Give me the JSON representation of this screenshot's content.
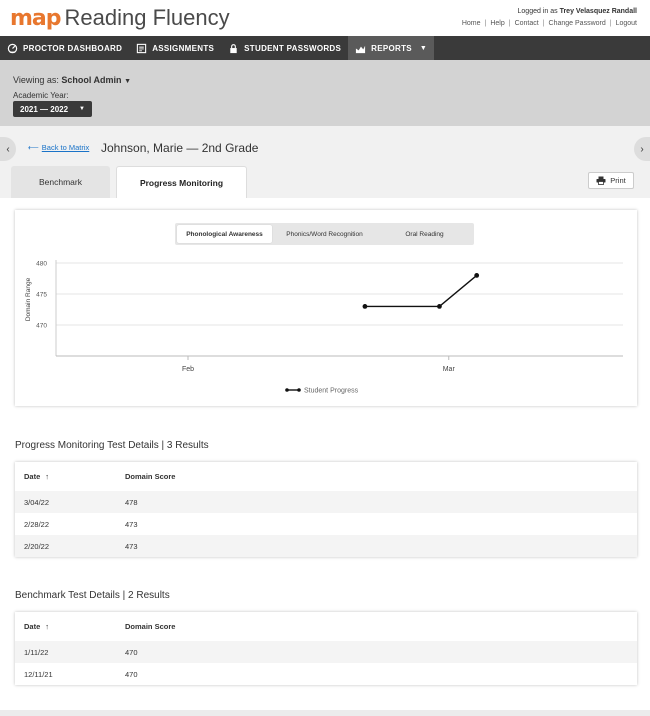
{
  "header": {
    "logo_map": "map",
    "logo_product": "Reading Fluency",
    "logged_in_prefix": "Logged in as",
    "logged_in_user": "Trey Velasquez Randall",
    "links": [
      "Home",
      "Help",
      "Contact",
      "Change Password",
      "Logout"
    ],
    "brand_color": "#e8772e"
  },
  "nav": {
    "items": [
      {
        "label": "PROCTOR DASHBOARD",
        "icon": "proctor-dashboard-icon"
      },
      {
        "label": "ASSIGNMENTS",
        "icon": "assignments-icon"
      },
      {
        "label": "STUDENT PASSWORDS",
        "icon": "lock-icon"
      },
      {
        "label": "REPORTS",
        "icon": "reports-icon"
      }
    ]
  },
  "subbar": {
    "viewing_label": "Viewing as:",
    "viewing_value": "School Admin",
    "academic_year_label": "Academic Year:",
    "academic_year_value": "2021 — 2022"
  },
  "student": {
    "back_label": "Back to Matrix",
    "name": "Johnson, Marie — 2nd Grade"
  },
  "tabs": [
    "Benchmark",
    "Progress Monitoring"
  ],
  "print_label": "Print",
  "chart_tabs": [
    "Phonological Awareness",
    "Phonics/Word Recognition",
    "Oral Reading"
  ],
  "chart_data": {
    "type": "line",
    "ylabel": "Domain Range",
    "yticks": [
      470,
      475,
      480
    ],
    "ylim": [
      465,
      480
    ],
    "xticks": [
      "Feb",
      "Mar"
    ],
    "series": [
      {
        "name": "Student Progress",
        "x": [
          "2022-02-20",
          "2022-02-28",
          "2022-03-04"
        ],
        "values": [
          473,
          473,
          478
        ]
      }
    ],
    "grid": true,
    "legend": "bottom-center"
  },
  "pm_table": {
    "title": "Progress Monitoring Test Details | 3 Results",
    "headers": [
      "Date",
      "Domain Score"
    ],
    "rows": [
      [
        "3/04/22",
        "478"
      ],
      [
        "2/28/22",
        "473"
      ],
      [
        "2/20/22",
        "473"
      ]
    ]
  },
  "bm_table": {
    "title": "Benchmark Test Details | 2 Results",
    "headers": [
      "Date",
      "Domain Score"
    ],
    "rows": [
      [
        "1/11/22",
        "470"
      ],
      [
        "12/11/21",
        "470"
      ]
    ]
  }
}
